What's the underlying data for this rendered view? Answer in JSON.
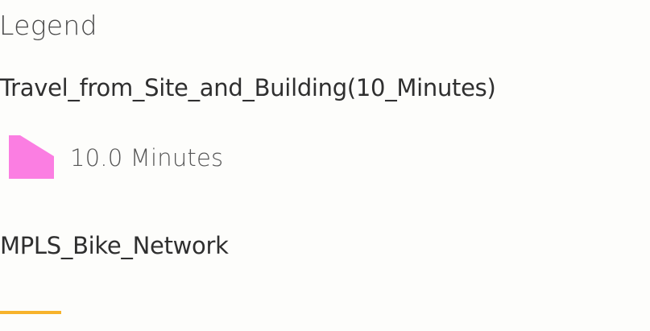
{
  "legend": {
    "heading": "Legend",
    "layers": [
      {
        "title": "Travel_from_Site_and_Building(10_Minutes)",
        "items": [
          {
            "label": "10.0 Minutes",
            "symbol": "polygon",
            "color": "#fb7ee2"
          }
        ]
      },
      {
        "title": "MPLS_Bike_Network",
        "items": [
          {
            "label": "",
            "symbol": "line",
            "color": "#f7b32b"
          }
        ]
      }
    ]
  }
}
